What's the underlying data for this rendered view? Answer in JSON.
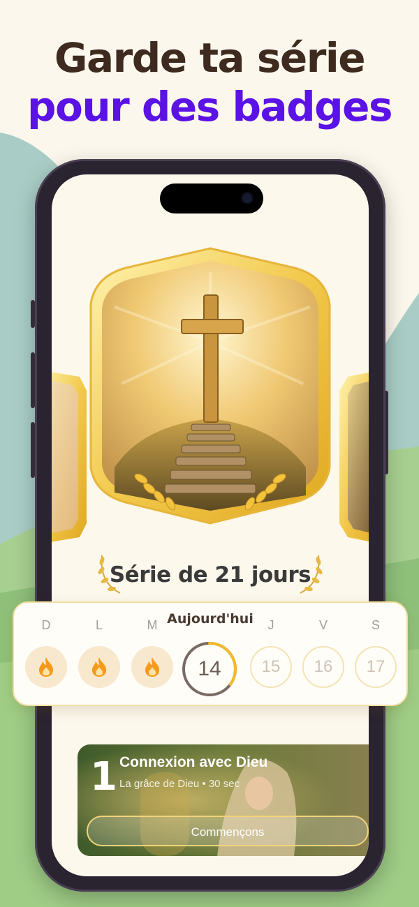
{
  "headline": {
    "part1": "Garde ta série",
    "accent": "pour des badges"
  },
  "badge": {
    "series_label": "Série de 21 jours"
  },
  "week": {
    "today_label": "Aujourd'hui",
    "days": [
      {
        "letter": "D",
        "value": "",
        "state": "done"
      },
      {
        "letter": "L",
        "value": "",
        "state": "done"
      },
      {
        "letter": "M",
        "value": "",
        "state": "done"
      },
      {
        "letter": "",
        "value": "14",
        "state": "today"
      },
      {
        "letter": "J",
        "value": "15",
        "state": "future"
      },
      {
        "letter": "V",
        "value": "16",
        "state": "future"
      },
      {
        "letter": "S",
        "value": "17",
        "state": "future"
      }
    ],
    "today_progress": 0.35
  },
  "session": {
    "number": "1",
    "title": "Connexion avec Dieu",
    "subtitle": "La grâce de Dieu • 30 sec",
    "button": "Commençons"
  },
  "colors": {
    "accent": "#5a12e6",
    "heading": "#3e2a1f",
    "gold": "#f2c94c",
    "flame": "#f59a1c"
  },
  "icons": [
    "flame-icon",
    "laurel-icon",
    "cross-icon"
  ]
}
